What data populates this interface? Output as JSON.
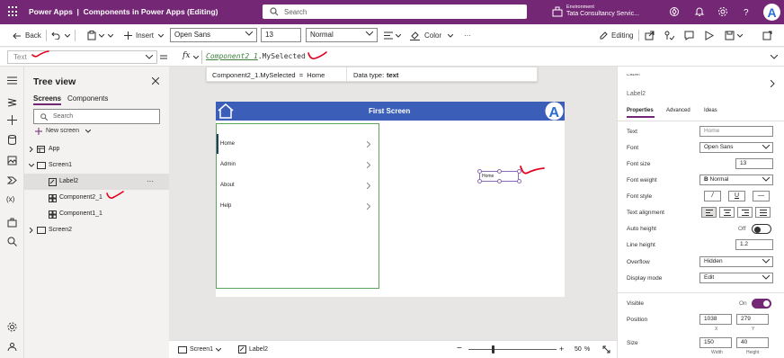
{
  "titlebar": {
    "app_name": "Power Apps",
    "separator": "|",
    "doc_title": "Components in Power Apps (Editing)",
    "search_placeholder": "Search",
    "env_label": "Environment",
    "env_name": "Tata Consultancy Servic...",
    "avatar_letter": "A"
  },
  "cmdbar": {
    "back": "Back",
    "insert": "Insert",
    "font": "Open Sans",
    "font_size": "13",
    "weight": "Normal",
    "color": "Color",
    "more": "···",
    "editing": "Editing"
  },
  "formula": {
    "property": "Text",
    "fx": "fx",
    "token": "Component2_1",
    "rest": ".MySelected",
    "popup_expr": "Component2_1.MySelected  =  Home",
    "popup_type_label": "Data type:",
    "popup_type_value": "text"
  },
  "tree": {
    "title": "Tree view",
    "tabs": [
      "Screens",
      "Components"
    ],
    "search_placeholder": "Search",
    "new_screen": "New screen",
    "more": "···",
    "nodes": [
      {
        "label": "App",
        "icon": "app-icon"
      },
      {
        "label": "Screen1",
        "icon": "screen-icon"
      },
      {
        "label": "Label2",
        "icon": "label-icon"
      },
      {
        "label": "Component2_1",
        "icon": "component-icon"
      },
      {
        "label": "Component1_1",
        "icon": "component-icon"
      },
      {
        "label": "Screen2",
        "icon": "screen-icon"
      }
    ]
  },
  "canvas": {
    "screen_title": "First Screen",
    "logo_letter": "A",
    "menu_items": [
      "Home",
      "Admin",
      "About",
      "Help"
    ],
    "label_text": "Home"
  },
  "statusbar": {
    "screen": "Screen1",
    "selected": "Label2",
    "zoom_minus": "−",
    "zoom_plus": "+",
    "zoom": "50",
    "zoom_unit": "%"
  },
  "props": {
    "header_cut": "Label",
    "name": "Label2",
    "tabs": [
      "Properties",
      "Advanced",
      "Ideas"
    ],
    "text_label": "Text",
    "text_value": "Home",
    "font_label": "Font",
    "font_value": "Open Sans",
    "font_size_label": "Font size",
    "font_size_value": "13",
    "font_weight_label": "Font weight",
    "font_weight_value": "Normal",
    "font_weight_b": "B",
    "font_style_label": "Font style",
    "font_style_i": "/",
    "font_style_u": "U",
    "font_style_s": "—",
    "text_align_label": "Text alignment",
    "auto_height_label": "Auto height",
    "auto_height_value": "Off",
    "auto_height_on": false,
    "line_height_label": "Line height",
    "line_height_value": "1.2",
    "overflow_label": "Overflow",
    "overflow_value": "Hidden",
    "display_mode_label": "Display mode",
    "display_mode_value": "Edit",
    "visible_label": "Visible",
    "visible_value": "On",
    "visible_on": true,
    "position_label": "Position",
    "pos_x": "1038",
    "pos_y": "279",
    "x_label": "X",
    "y_label": "Y",
    "size_label": "Size",
    "width": "150",
    "height": "40",
    "width_label": "Width",
    "height_label": "Height"
  },
  "colors": {
    "brand": "#742774",
    "screen_header": "#3b5fb8",
    "annotation_red": "#e3001b",
    "selection": "#8a6bb4"
  }
}
